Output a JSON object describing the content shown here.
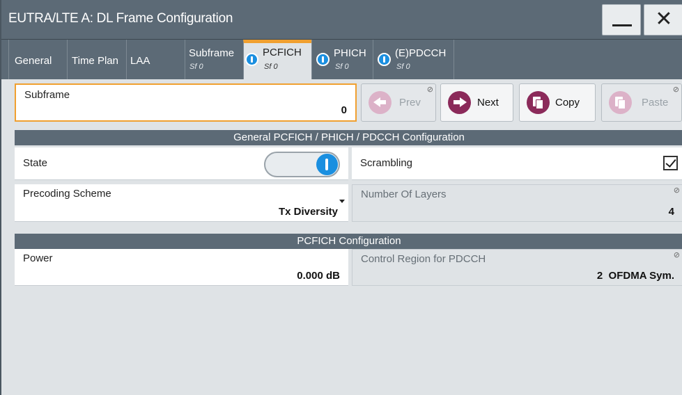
{
  "window": {
    "title": "EUTRA/LTE A: DL Frame Configuration",
    "minimize_icon": "minimize-icon",
    "close_icon": "close-icon"
  },
  "tabs": [
    {
      "label": "General",
      "sub": ""
    },
    {
      "label": "Time Plan",
      "sub": ""
    },
    {
      "label": "LAA",
      "sub": ""
    },
    {
      "label": "Subframe",
      "sub": "Sf 0"
    },
    {
      "label": "PCFICH",
      "sub": "Sf 0",
      "active": true,
      "icon": "info-icon"
    },
    {
      "label": "PHICH",
      "sub": "Sf 0",
      "icon": "info-icon"
    },
    {
      "label": "(E)PDCCH",
      "sub": "Sf 0",
      "icon": "info-icon"
    }
  ],
  "subframe": {
    "label": "Subframe",
    "value": "0"
  },
  "buttons": {
    "prev": "Prev",
    "next": "Next",
    "copy": "Copy",
    "paste": "Paste"
  },
  "general_section": {
    "title": "General PCFICH / PHICH / PDCCH Configuration",
    "state_label": "State",
    "state_on": true,
    "scrambling_label": "Scrambling",
    "scrambling_checked": true,
    "precoding_label": "Precoding Scheme",
    "precoding_value": "Tx Diversity",
    "layers_label": "Number Of Layers",
    "layers_value": "4"
  },
  "pcfich_section": {
    "title": "PCFICH Configuration",
    "power_label": "Power",
    "power_value": "0.000 dB",
    "control_label": "Control Region for PDCCH",
    "control_value": "2  OFDMA Sym."
  },
  "colors": {
    "titlebar": "#5c6a76",
    "accent_orange": "#f0a030",
    "info_blue": "#1a8fe0",
    "button_magenta": "#8b2a5a"
  }
}
